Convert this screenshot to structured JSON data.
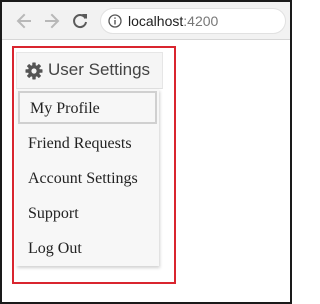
{
  "browser": {
    "url_host": "localhost",
    "url_port": ":4200"
  },
  "dropdown": {
    "label": "User Settings",
    "items": [
      {
        "label": "My Profile"
      },
      {
        "label": "Friend Requests"
      },
      {
        "label": "Account Settings"
      },
      {
        "label": "Support"
      },
      {
        "label": "Log Out"
      }
    ]
  },
  "colors": {
    "highlight_border": "#d9252f",
    "menu_background": "#f7f7f7"
  },
  "icons": [
    "back-arrow-icon",
    "forward-arrow-icon",
    "reload-icon",
    "info-icon",
    "gear-icon"
  ]
}
